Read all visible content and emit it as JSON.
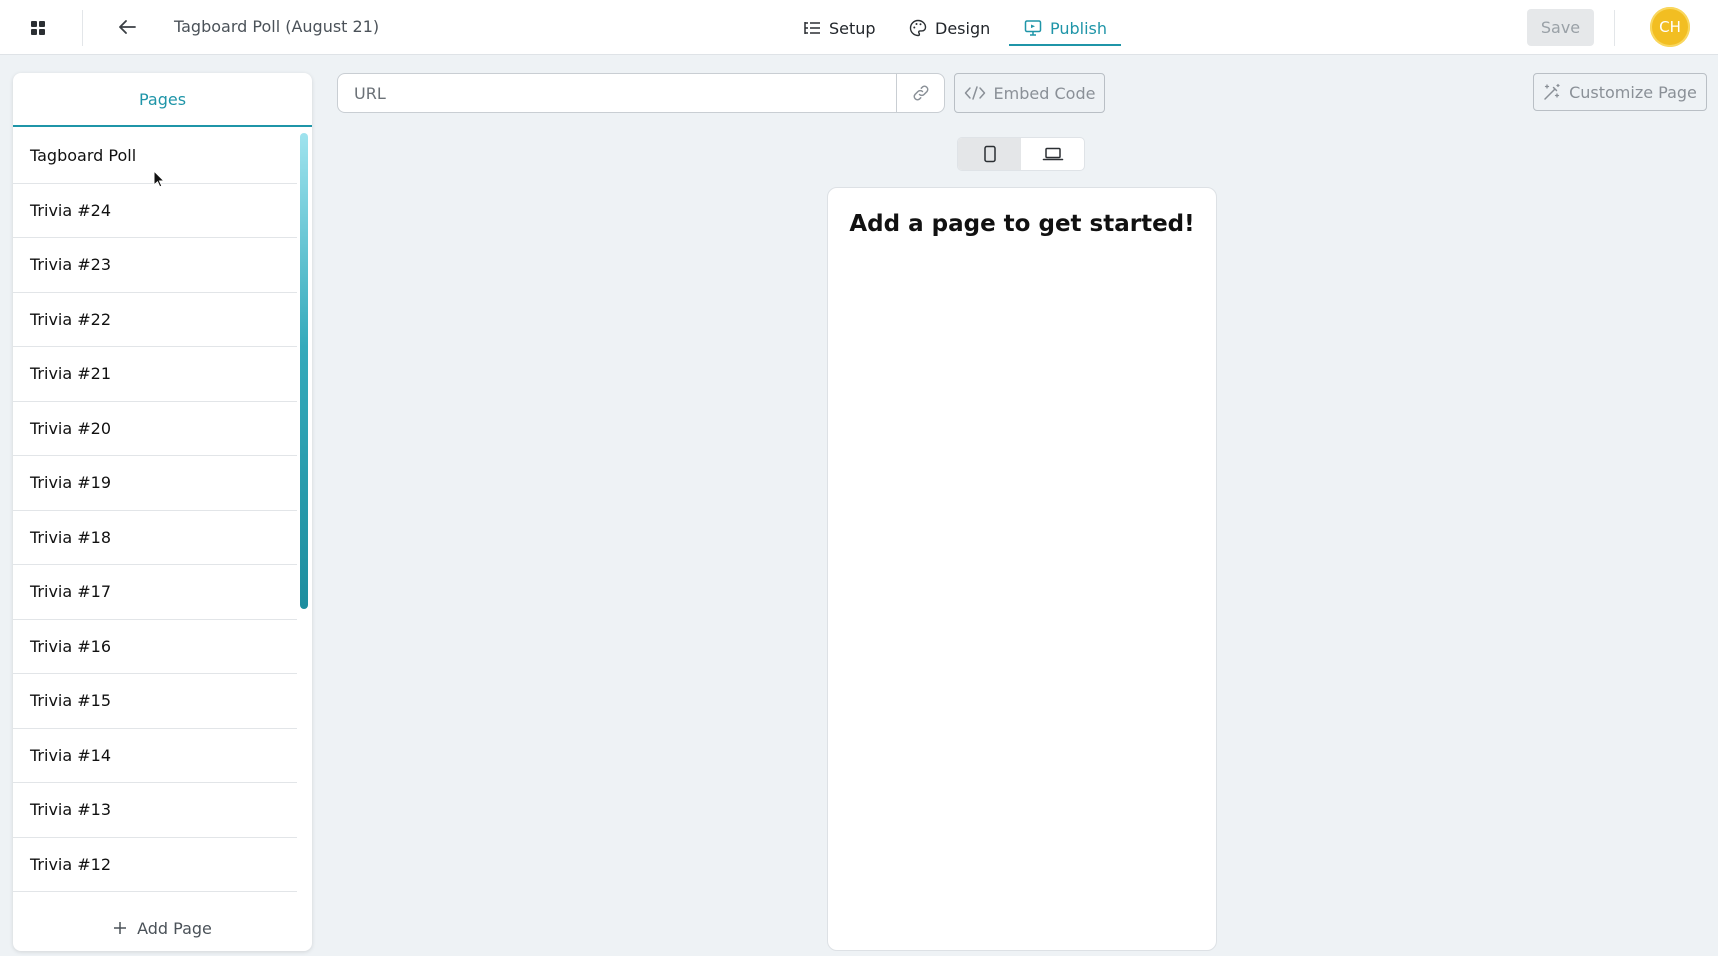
{
  "header": {
    "title": "Tagboard Poll (August 21)",
    "nav": [
      {
        "label": "Setup",
        "icon": "setup-list-icon"
      },
      {
        "label": "Design",
        "icon": "palette-icon"
      },
      {
        "label": "Publish",
        "icon": "monitor-icon",
        "active": true
      }
    ],
    "save_label": "Save",
    "avatar_initials": "CH"
  },
  "pages_panel": {
    "tab_label": "Pages",
    "items": [
      {
        "label": "Tagboard Poll"
      },
      {
        "label": "Trivia #24"
      },
      {
        "label": "Trivia #23"
      },
      {
        "label": "Trivia #22"
      },
      {
        "label": "Trivia #21"
      },
      {
        "label": "Trivia #20"
      },
      {
        "label": "Trivia #19"
      },
      {
        "label": "Trivia #18"
      },
      {
        "label": "Trivia #17"
      },
      {
        "label": "Trivia #16"
      },
      {
        "label": "Trivia #15"
      },
      {
        "label": "Trivia #14"
      },
      {
        "label": "Trivia #13"
      },
      {
        "label": "Trivia #12"
      }
    ],
    "add_page_label": "Add Page"
  },
  "publish": {
    "url_placeholder": "URL",
    "url_value": "",
    "embed_code_label": "Embed Code",
    "customize_label": "Customize Page",
    "device_selected": "mobile",
    "preview_message": "Add a page to get started!"
  },
  "colors": {
    "accent": "#1f95a8",
    "background": "#eef2f5",
    "avatar": "#f2be22"
  }
}
